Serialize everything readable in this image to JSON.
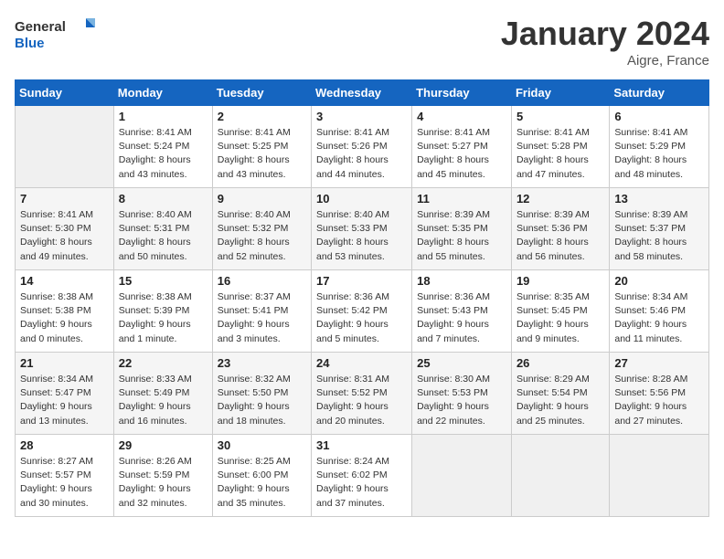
{
  "header": {
    "logo_general": "General",
    "logo_blue": "Blue",
    "month": "January 2024",
    "location": "Aigre, France"
  },
  "columns": [
    "Sunday",
    "Monday",
    "Tuesday",
    "Wednesday",
    "Thursday",
    "Friday",
    "Saturday"
  ],
  "weeks": [
    [
      {
        "day": "",
        "sunrise": "",
        "sunset": "",
        "daylight": ""
      },
      {
        "day": "1",
        "sunrise": "Sunrise: 8:41 AM",
        "sunset": "Sunset: 5:24 PM",
        "daylight": "Daylight: 8 hours and 43 minutes."
      },
      {
        "day": "2",
        "sunrise": "Sunrise: 8:41 AM",
        "sunset": "Sunset: 5:25 PM",
        "daylight": "Daylight: 8 hours and 43 minutes."
      },
      {
        "day": "3",
        "sunrise": "Sunrise: 8:41 AM",
        "sunset": "Sunset: 5:26 PM",
        "daylight": "Daylight: 8 hours and 44 minutes."
      },
      {
        "day": "4",
        "sunrise": "Sunrise: 8:41 AM",
        "sunset": "Sunset: 5:27 PM",
        "daylight": "Daylight: 8 hours and 45 minutes."
      },
      {
        "day": "5",
        "sunrise": "Sunrise: 8:41 AM",
        "sunset": "Sunset: 5:28 PM",
        "daylight": "Daylight: 8 hours and 47 minutes."
      },
      {
        "day": "6",
        "sunrise": "Sunrise: 8:41 AM",
        "sunset": "Sunset: 5:29 PM",
        "daylight": "Daylight: 8 hours and 48 minutes."
      }
    ],
    [
      {
        "day": "7",
        "sunrise": "Sunrise: 8:41 AM",
        "sunset": "Sunset: 5:30 PM",
        "daylight": "Daylight: 8 hours and 49 minutes."
      },
      {
        "day": "8",
        "sunrise": "Sunrise: 8:40 AM",
        "sunset": "Sunset: 5:31 PM",
        "daylight": "Daylight: 8 hours and 50 minutes."
      },
      {
        "day": "9",
        "sunrise": "Sunrise: 8:40 AM",
        "sunset": "Sunset: 5:32 PM",
        "daylight": "Daylight: 8 hours and 52 minutes."
      },
      {
        "day": "10",
        "sunrise": "Sunrise: 8:40 AM",
        "sunset": "Sunset: 5:33 PM",
        "daylight": "Daylight: 8 hours and 53 minutes."
      },
      {
        "day": "11",
        "sunrise": "Sunrise: 8:39 AM",
        "sunset": "Sunset: 5:35 PM",
        "daylight": "Daylight: 8 hours and 55 minutes."
      },
      {
        "day": "12",
        "sunrise": "Sunrise: 8:39 AM",
        "sunset": "Sunset: 5:36 PM",
        "daylight": "Daylight: 8 hours and 56 minutes."
      },
      {
        "day": "13",
        "sunrise": "Sunrise: 8:39 AM",
        "sunset": "Sunset: 5:37 PM",
        "daylight": "Daylight: 8 hours and 58 minutes."
      }
    ],
    [
      {
        "day": "14",
        "sunrise": "Sunrise: 8:38 AM",
        "sunset": "Sunset: 5:38 PM",
        "daylight": "Daylight: 9 hours and 0 minutes."
      },
      {
        "day": "15",
        "sunrise": "Sunrise: 8:38 AM",
        "sunset": "Sunset: 5:39 PM",
        "daylight": "Daylight: 9 hours and 1 minute."
      },
      {
        "day": "16",
        "sunrise": "Sunrise: 8:37 AM",
        "sunset": "Sunset: 5:41 PM",
        "daylight": "Daylight: 9 hours and 3 minutes."
      },
      {
        "day": "17",
        "sunrise": "Sunrise: 8:36 AM",
        "sunset": "Sunset: 5:42 PM",
        "daylight": "Daylight: 9 hours and 5 minutes."
      },
      {
        "day": "18",
        "sunrise": "Sunrise: 8:36 AM",
        "sunset": "Sunset: 5:43 PM",
        "daylight": "Daylight: 9 hours and 7 minutes."
      },
      {
        "day": "19",
        "sunrise": "Sunrise: 8:35 AM",
        "sunset": "Sunset: 5:45 PM",
        "daylight": "Daylight: 9 hours and 9 minutes."
      },
      {
        "day": "20",
        "sunrise": "Sunrise: 8:34 AM",
        "sunset": "Sunset: 5:46 PM",
        "daylight": "Daylight: 9 hours and 11 minutes."
      }
    ],
    [
      {
        "day": "21",
        "sunrise": "Sunrise: 8:34 AM",
        "sunset": "Sunset: 5:47 PM",
        "daylight": "Daylight: 9 hours and 13 minutes."
      },
      {
        "day": "22",
        "sunrise": "Sunrise: 8:33 AM",
        "sunset": "Sunset: 5:49 PM",
        "daylight": "Daylight: 9 hours and 16 minutes."
      },
      {
        "day": "23",
        "sunrise": "Sunrise: 8:32 AM",
        "sunset": "Sunset: 5:50 PM",
        "daylight": "Daylight: 9 hours and 18 minutes."
      },
      {
        "day": "24",
        "sunrise": "Sunrise: 8:31 AM",
        "sunset": "Sunset: 5:52 PM",
        "daylight": "Daylight: 9 hours and 20 minutes."
      },
      {
        "day": "25",
        "sunrise": "Sunrise: 8:30 AM",
        "sunset": "Sunset: 5:53 PM",
        "daylight": "Daylight: 9 hours and 22 minutes."
      },
      {
        "day": "26",
        "sunrise": "Sunrise: 8:29 AM",
        "sunset": "Sunset: 5:54 PM",
        "daylight": "Daylight: 9 hours and 25 minutes."
      },
      {
        "day": "27",
        "sunrise": "Sunrise: 8:28 AM",
        "sunset": "Sunset: 5:56 PM",
        "daylight": "Daylight: 9 hours and 27 minutes."
      }
    ],
    [
      {
        "day": "28",
        "sunrise": "Sunrise: 8:27 AM",
        "sunset": "Sunset: 5:57 PM",
        "daylight": "Daylight: 9 hours and 30 minutes."
      },
      {
        "day": "29",
        "sunrise": "Sunrise: 8:26 AM",
        "sunset": "Sunset: 5:59 PM",
        "daylight": "Daylight: 9 hours and 32 minutes."
      },
      {
        "day": "30",
        "sunrise": "Sunrise: 8:25 AM",
        "sunset": "Sunset: 6:00 PM",
        "daylight": "Daylight: 9 hours and 35 minutes."
      },
      {
        "day": "31",
        "sunrise": "Sunrise: 8:24 AM",
        "sunset": "Sunset: 6:02 PM",
        "daylight": "Daylight: 9 hours and 37 minutes."
      },
      {
        "day": "",
        "sunrise": "",
        "sunset": "",
        "daylight": ""
      },
      {
        "day": "",
        "sunrise": "",
        "sunset": "",
        "daylight": ""
      },
      {
        "day": "",
        "sunrise": "",
        "sunset": "",
        "daylight": ""
      }
    ]
  ]
}
